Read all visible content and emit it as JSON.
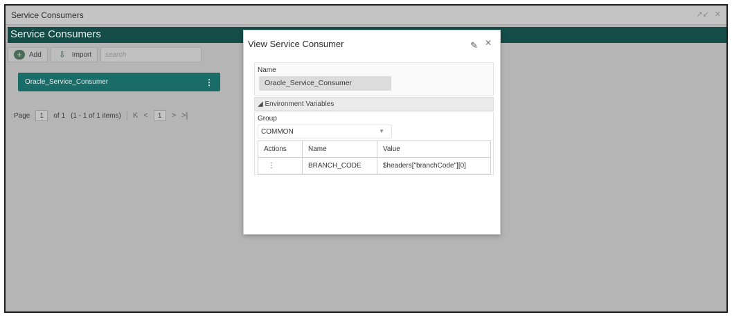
{
  "window": {
    "title": "Service Consumers",
    "controls": [
      "↗↙",
      "✕"
    ]
  },
  "header": {
    "title": "Service Consumers"
  },
  "toolbar": {
    "add_label": "Add",
    "import_label": "Import",
    "search_placeholder": "search"
  },
  "consumers": [
    {
      "name": "Oracle_Service_Consumer",
      "menu": "⋮"
    }
  ],
  "pager": {
    "page_label": "Page",
    "page_value": "1",
    "of_text": "of 1",
    "items_text": "(1 - 1 of 1 items)",
    "first": "K",
    "prev": "<",
    "current": "1",
    "next": ">",
    "last": ">|"
  },
  "modal": {
    "title": "View Service Consumer",
    "edit_icon": "✎",
    "close_icon": "✕",
    "name_label": "Name",
    "name_value": "Oracle_Service_Consumer",
    "env_section": "◢ Environment Variables",
    "group_label": "Group",
    "group_value": "COMMON",
    "table": {
      "headers": [
        "Actions",
        "Name",
        "Value"
      ],
      "rows": [
        {
          "action": "⋮",
          "name": "BRANCH_CODE",
          "value": "$headers[\"branchCode\"][0]"
        }
      ]
    }
  },
  "colors": {
    "header_bg": "#144c48",
    "card_bg": "#196c67",
    "overlay_bg": "#b5b5b5"
  }
}
